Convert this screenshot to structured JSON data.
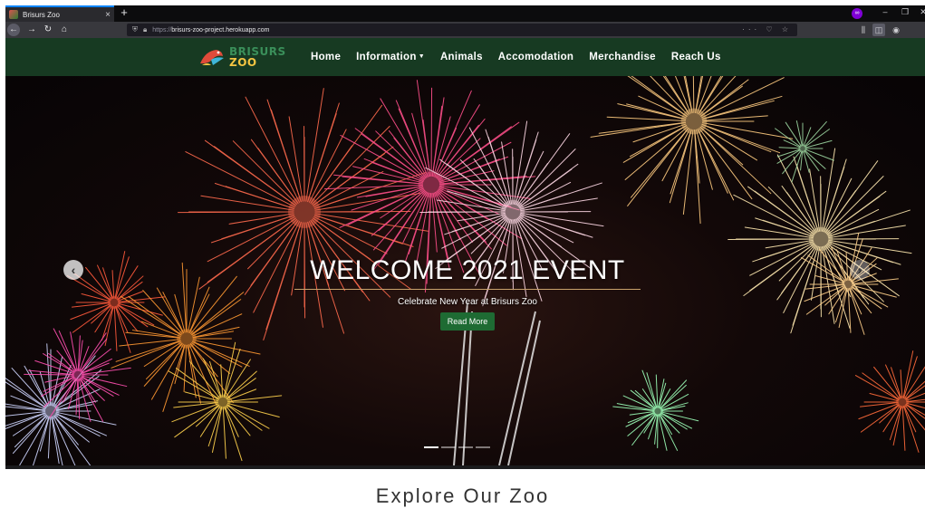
{
  "browser": {
    "tab_title": "Brisurs Zoo",
    "tab_close": "×",
    "new_tab": "+",
    "url_scheme": "https://",
    "url_host": "brisurs-zoo-project.herokuapp.com",
    "url_actions": "··· ♡ ☆"
  },
  "site": {
    "logo_top": "BRISURS",
    "logo_bottom": "ZOO",
    "nav": [
      {
        "label": "Home"
      },
      {
        "label": "Information",
        "dropdown": true
      },
      {
        "label": "Animals"
      },
      {
        "label": "Accomodation"
      },
      {
        "label": "Merchandise"
      },
      {
        "label": "Reach Us"
      }
    ],
    "colors": {
      "header": "#173a22",
      "button": "#1e6b33"
    }
  },
  "hero": {
    "title": "WELCOME 2021 EVENT",
    "subtitle": "Celebrate New Year at Brisurs Zoo",
    "button": "Read More",
    "slides": 4,
    "active_slide": 1
  },
  "section": {
    "title": "Explore Our Zoo"
  }
}
